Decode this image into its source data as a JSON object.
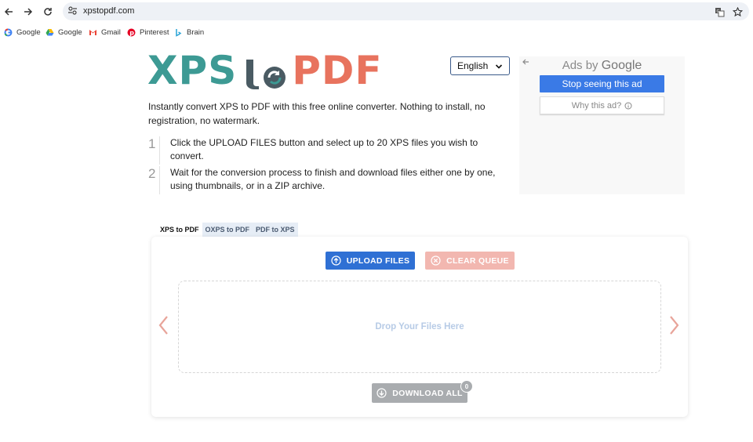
{
  "browser": {
    "url": "xpstopdf.com",
    "bookmarks": [
      {
        "label": "Google",
        "icon": "google-icon"
      },
      {
        "label": "Google",
        "icon": "google-drive-icon"
      },
      {
        "label": "Gmail",
        "icon": "gmail-icon"
      },
      {
        "label": "Pinterest",
        "icon": "pinterest-icon"
      },
      {
        "label": "Brain",
        "icon": "brain-icon"
      }
    ]
  },
  "logo": {
    "part1": "XPS",
    "part2": "to",
    "part3": "PDF"
  },
  "language": {
    "selected": "English"
  },
  "intro": "Instantly convert XPS to PDF with this free online converter. Nothing to install, no registration, no watermark.",
  "steps": [
    {
      "num": "1",
      "text": "Click the UPLOAD FILES button and select up to 20 XPS files you wish to convert."
    },
    {
      "num": "2",
      "text": "Wait for the conversion process to finish and download files either one by one, using thumbnails, or in a ZIP archive."
    }
  ],
  "ad": {
    "ads_by": "Ads by",
    "google": "Google",
    "stop": "Stop seeing this ad",
    "why": "Why this ad?"
  },
  "tabs": [
    {
      "label": "XPS to PDF",
      "active": true
    },
    {
      "label": "OXPS to PDF",
      "active": false
    },
    {
      "label": "PDF to XPS",
      "active": false
    }
  ],
  "converter": {
    "upload_label": "UPLOAD FILES",
    "clear_label": "CLEAR QUEUE",
    "drop_label": "Drop Your Files Here",
    "download_label": "DOWNLOAD ALL",
    "download_count": "0"
  },
  "colors": {
    "xps": "#3d9a94",
    "pdf": "#e8735e",
    "upload": "#2f70d4",
    "clear": "#f2b7b0",
    "arrows": "#e8a49a"
  }
}
